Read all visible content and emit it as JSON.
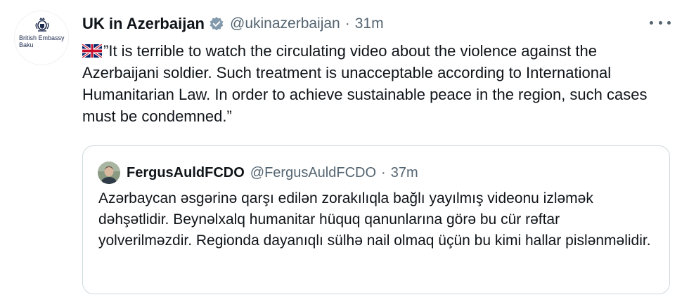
{
  "tweet": {
    "author": {
      "avatar_text": "British Embassy Baku",
      "name": "UK in Azerbaijan",
      "handle": "@ukinazerbaijan"
    },
    "separator": "·",
    "time": "31m",
    "text": "”It is terrible to watch the circulating video about the violence against the Azerbaijani soldier. Such treatment is unacceptable according to International Humanitarian Law. In order to achieve sustainable peace in the region, such cases must be condemned.”"
  },
  "quoted_tweet": {
    "author": {
      "name": "FergusAuldFCDO",
      "handle": "@FergusAuldFCDO"
    },
    "separator": "·",
    "time": "37m",
    "text": "Azərbaycan əsgərinə qarşı edilən zorakılıqla bağlı yayılmış videonu izləmək dəhşətlidir. Beynəlxalq humanitar hüquq qanunlarına görə bu cür rəftar yolverilməzdir. Regionda dayanıqlı sülhə nail olmaq üçün bu kimi hallar pislənməlidir."
  },
  "icons": {
    "verified": "verified-badge-icon",
    "flag": "uk-flag-icon",
    "more": "more-options-icon"
  },
  "colors": {
    "verified_gray": "#829aab",
    "secondary_text": "#536471",
    "border": "#cfd9de"
  }
}
